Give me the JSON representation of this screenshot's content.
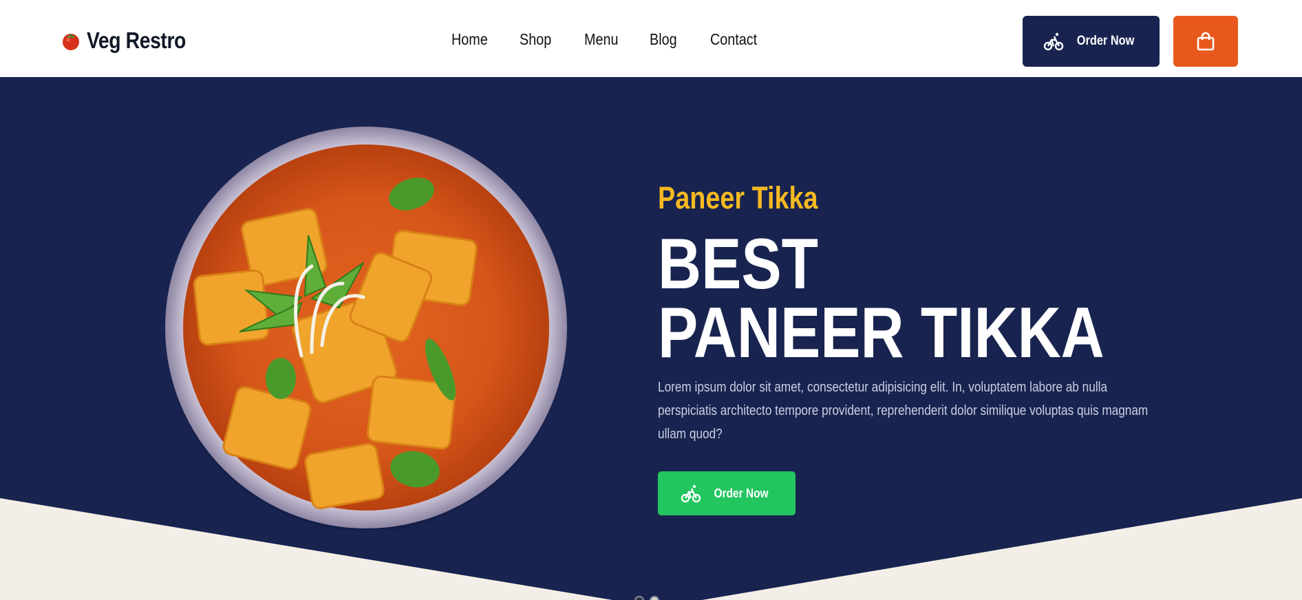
{
  "brand": {
    "name": "Veg Restro",
    "logo_icon": "tomato-icon"
  },
  "nav": {
    "items": [
      "Home",
      "Shop",
      "Menu",
      "Blog",
      "Contact"
    ]
  },
  "header": {
    "order_label": "Order Now",
    "order_icon": "bicycle-icon",
    "cart_icon": "shopping-bag-icon"
  },
  "hero": {
    "subtitle": "Paneer Tikka",
    "title_line1": "BEST",
    "title_line2": "PANEER TIKKA",
    "description": "Lorem ipsum dolor sit amet, consectetur adipisicing elit. In, voluptatem labore ab nulla perspiciatis architecto tempore provident, reprehenderit dolor similique voluptas quis magnam ullam quod?",
    "order_label": "Order Now",
    "slider": {
      "count": 2,
      "active": 1
    }
  },
  "colors": {
    "navy": "#18244f",
    "orange": "#e8581c",
    "yellow": "#f5b921",
    "green": "#22c55e",
    "cream": "#f3efe8"
  }
}
